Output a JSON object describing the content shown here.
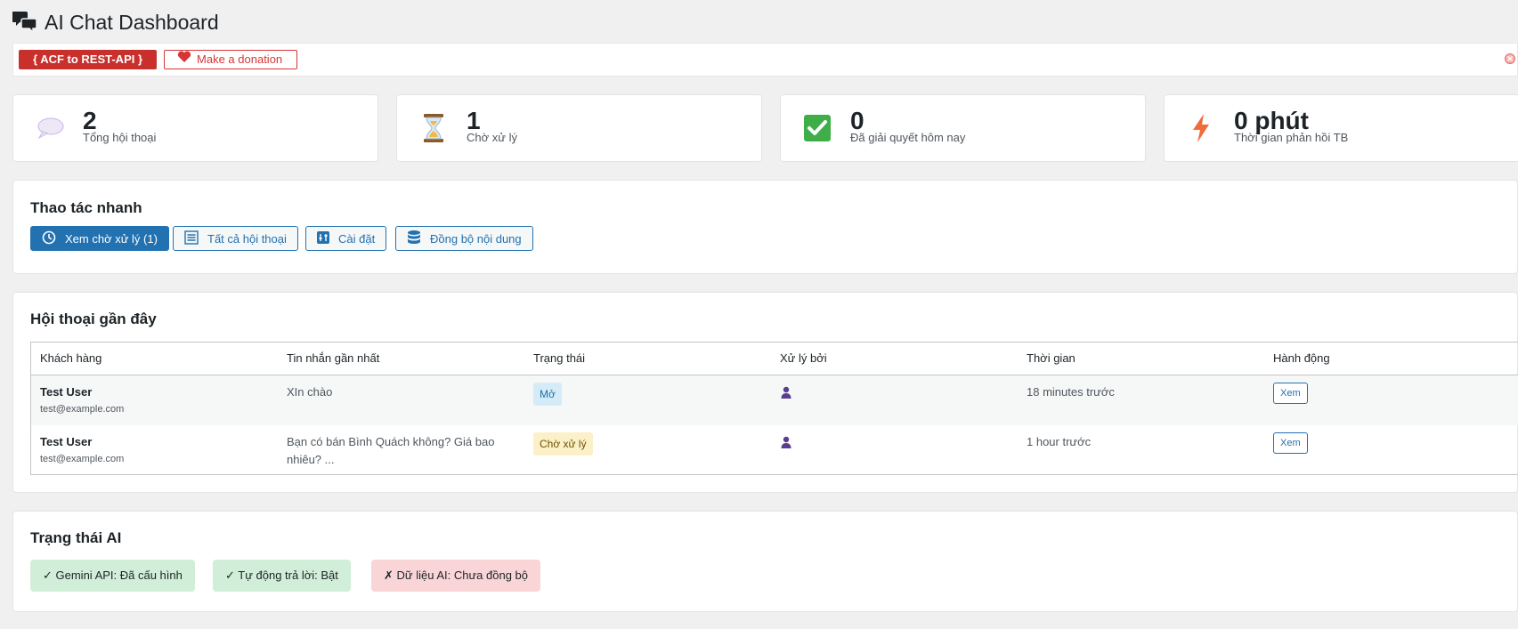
{
  "header": {
    "title": "AI Chat Dashboard",
    "icon": "chat-bubbles-icon"
  },
  "notice": {
    "acf_label": "{ ACF to REST-API }",
    "donate_label": "Make a donation",
    "close_symbol": "✕"
  },
  "stats": [
    {
      "value": "2",
      "label": "Tổng hội thoại",
      "icon": "speech-bubble-icon"
    },
    {
      "value": "1",
      "label": "Chờ xử lý",
      "icon": "hourglass-icon"
    },
    {
      "value": "0",
      "label": "Đã giải quyết hôm nay",
      "icon": "check-mark-icon"
    },
    {
      "value": "0 phút",
      "label": "Thời gian phản hồi TB",
      "icon": "lightning-icon"
    }
  ],
  "quick_actions": {
    "title": "Thao tác nhanh",
    "buttons": [
      {
        "label": "Xem chờ xử lý (1)",
        "icon": "clock-icon"
      },
      {
        "label": "Tất cả hội thoại",
        "icon": "list-icon"
      },
      {
        "label": "Cài đặt",
        "icon": "sliders-icon"
      },
      {
        "label": "Đồng bộ nội dung",
        "icon": "database-icon"
      }
    ]
  },
  "recent": {
    "title": "Hội thoại gần đây",
    "columns": [
      "Khách hàng",
      "Tin nhắn gần nhất",
      "Trạng thái",
      "Xử lý bởi",
      "Thời gian",
      "Hành động"
    ],
    "rows": [
      {
        "name": "Test User",
        "email": "test@example.com",
        "message": "XIn chào",
        "message2": "",
        "status": "Mở",
        "handler_icon": "user-icon",
        "time": "18 minutes trước",
        "action": "Xem"
      },
      {
        "name": "Test User",
        "email": "test@example.com",
        "message": "Bạn có bán Bình Quách không? Giá bao",
        "message2": "nhiêu? ...",
        "status": "Chờ xử lý",
        "handler_icon": "user-icon",
        "time": "1 hour trước",
        "action": "Xem"
      }
    ]
  },
  "ai_status": {
    "title": "Trạng thái AI",
    "items": [
      {
        "label": "✓  Gemini API: Đã cấu hình",
        "state": "ok"
      },
      {
        "label": "✓  Tự động trả lời: Bật",
        "state": "ok"
      },
      {
        "label": "✗  Dữ liệu AI: Chưa đồng bộ",
        "state": "bad"
      }
    ]
  },
  "colors": {
    "primary": "#2271b1",
    "danger": "#c9302c",
    "ok_bg": "#d1eed9",
    "bad_bg": "#f9d5d7"
  }
}
